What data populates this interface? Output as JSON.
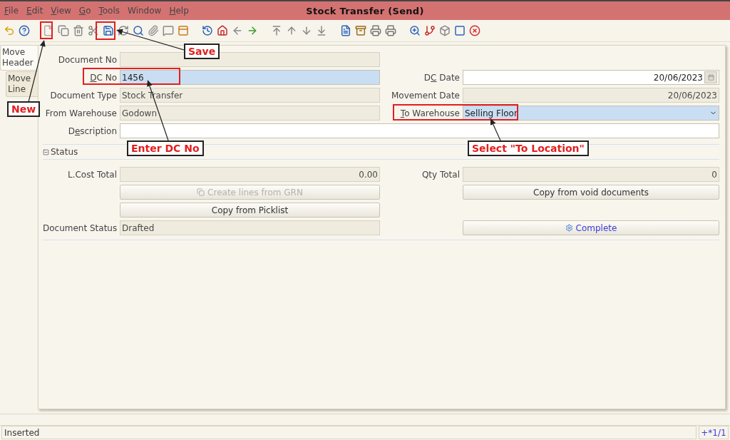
{
  "window": {
    "title": "Stock Transfer (Send)"
  },
  "menu": [
    {
      "label": {
        "key": "F",
        "post": "ile"
      }
    },
    {
      "label": {
        "key": "E",
        "post": "dit"
      }
    },
    {
      "label": {
        "key": "V",
        "post": "iew"
      }
    },
    {
      "label": {
        "key": "G",
        "post": "o"
      }
    },
    {
      "label": {
        "key": "T",
        "post": "ools"
      }
    },
    {
      "label": {
        "pre": "Window"
      }
    },
    {
      "label": {
        "key": "H",
        "post": "elp"
      }
    }
  ],
  "tabs": [
    {
      "label": "Move Header",
      "selected": true
    },
    {
      "label": "Move Line",
      "selected": false
    }
  ],
  "header_rows": [
    [
      {
        "kind": "text",
        "label": {
          "pre": "Document No"
        },
        "readonly": true,
        "mandatory": false
      }
    ],
    [
      {
        "kind": "text",
        "label": {
          "key": "D",
          "post": "C No"
        },
        "readonly": false,
        "mandatory": true,
        "value": "1456"
      },
      {
        "kind": "date",
        "label": {
          "pre": "D",
          "key": "C",
          "post": " Date"
        },
        "readonly": false,
        "mandatory": false,
        "value": "20/06/2023"
      }
    ],
    [
      {
        "kind": "text",
        "label": {
          "pre": "Document Type"
        },
        "readonly": true,
        "mandatory": false,
        "value": "Stock Transfer"
      },
      {
        "kind": "number",
        "label": {
          "pre": "Movement Date"
        },
        "readonly": true,
        "mandatory": false,
        "value": "20/06/2023"
      }
    ],
    [
      {
        "kind": "text",
        "label": {
          "pre": "From Warehouse"
        },
        "readonly": true,
        "mandatory": false,
        "value": "Godown"
      },
      {
        "kind": "select",
        "label": {
          "key": "T",
          "post": "o Warehouse"
        },
        "readonly": false,
        "mandatory": true,
        "value": "Selling Floor"
      }
    ],
    [
      {
        "kind": "wide",
        "label": {
          "pre": "D",
          "key": "e",
          "post": "scription"
        },
        "readonly": false,
        "mandatory": false
      }
    ]
  ],
  "status_section": {
    "title": "Status",
    "expanded": true
  },
  "status_rows": [
    [
      {
        "kind": "number",
        "label": {
          "pre": "L.Cost Total"
        },
        "readonly": true,
        "mandatory": false,
        "value": "0.00"
      },
      {
        "kind": "number",
        "label": {
          "pre": "Qty Total"
        },
        "readonly": true,
        "mandatory": false,
        "value": "0"
      }
    ],
    [
      {
        "kind": "iconbutton",
        "label": "Create lines from GRN",
        "disabled": true
      },
      {
        "kind": "button",
        "label": "Copy from void documents",
        "disabled": false
      }
    ],
    [
      {
        "kind": "button",
        "label": "Copy from Picklist",
        "disabled": false
      }
    ],
    [
      {
        "kind": "text",
        "label": {
          "pre": "Document Status"
        },
        "readonly": true,
        "mandatory": false,
        "value": "Drafted"
      },
      {
        "kind": "process",
        "label": "Complete",
        "disabled": false
      }
    ]
  ],
  "annotations": [
    {
      "text": "New"
    },
    {
      "text": "Save"
    },
    {
      "text": "Enter DC No"
    },
    {
      "text": "Select \"To Location\""
    }
  ],
  "status_bar": {
    "message": "Inserted",
    "record": "+*1/1"
  }
}
